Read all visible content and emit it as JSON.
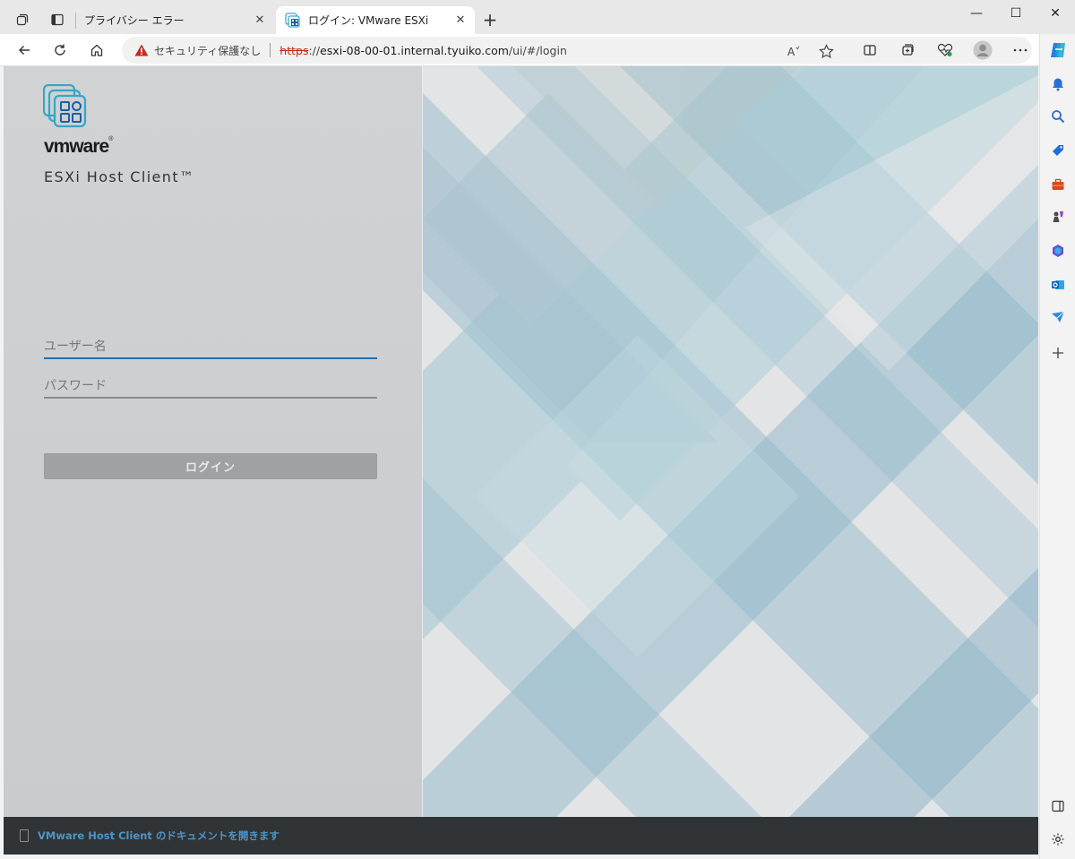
{
  "browser": {
    "tabs": [
      {
        "label": "プライバシー エラー",
        "close_symbol": "✕",
        "active": false
      },
      {
        "label": "ログイン: VMware ESXi",
        "close_symbol": "✕",
        "active": true
      }
    ],
    "new_tab_symbol": "+",
    "window_controls": {
      "minimize": "—",
      "maximize": "☐",
      "close": "✕"
    },
    "address_bar": {
      "security_label": "セキュリティ保護なし",
      "url_scheme": "https",
      "url_host": "esxi-08-00-01.internal.tyuiko.com",
      "url_path": "/ui/#/login"
    },
    "toolbar_icons": [
      "tab-actions-icon",
      "vertical-tabs-icon",
      "back-icon",
      "refresh-icon",
      "home-icon",
      "read-aloud-icon",
      "favorite-star-icon",
      "split-screen-icon",
      "collections-icon",
      "browser-essentials-icon",
      "profile-icon",
      "more-icon",
      "copilot-icon"
    ],
    "sidebar_icons": [
      "notifications-icon",
      "search-icon",
      "shopping-icon",
      "tools-icon",
      "games-icon",
      "microsoft-365-icon",
      "outlook-icon",
      "drop-icon",
      "add-icon",
      "hide-sidebar-icon",
      "settings-icon"
    ]
  },
  "login": {
    "brand": "vmware",
    "brand_mark": "®",
    "product_name": "ESXi Host Client™",
    "username_placeholder": "ユーザー名",
    "password_placeholder": "パスワード",
    "login_button": "ログイン"
  },
  "footer": {
    "doc_link": "VMware Host Client のドキュメントを開きます"
  },
  "colors": {
    "accent_blue": "#1f70b0",
    "security_warning": "#c42b1c",
    "panel_gray": "#cdcfd1",
    "footer_dark": "#313436",
    "doc_link": "#4e95c7"
  }
}
